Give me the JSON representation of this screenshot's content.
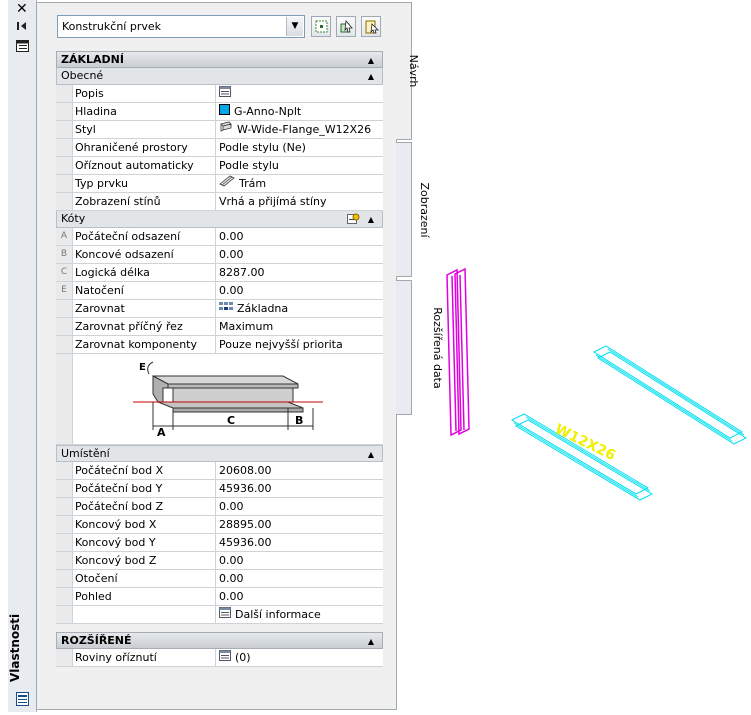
{
  "palette": {
    "title": "Vlastnosti",
    "object_type": "Konstrukční prvek",
    "tabs": [
      "Návrh",
      "Zobrazení",
      "Rozšířená data"
    ]
  },
  "sections": {
    "zakladni": {
      "label": "ZÁKLADNÍ",
      "obecne": {
        "label": "Obecné",
        "rows": [
          {
            "name": "Popis",
            "value": "",
            "icon": "list-icon"
          },
          {
            "name": "Hladina",
            "value": "G-Anno-Nplt",
            "icon": "layer-color-swatch"
          },
          {
            "name": "Styl",
            "value": "W-Wide-Flange_W12X26",
            "icon": "beam-style-icon"
          },
          {
            "name": "Ohraničené prostory",
            "value": "Podle stylu (Ne)"
          },
          {
            "name": "Oříznout automaticky",
            "value": "Podle stylu"
          },
          {
            "name": "Typ prvku",
            "value": "Trám",
            "icon": "beam-icon"
          },
          {
            "name": "Zobrazení stínů",
            "value": "Vrhá a přijímá stíny"
          }
        ]
      },
      "koty": {
        "label": "Kóty",
        "rows": [
          {
            "gutter": "A",
            "name": "Počáteční odsazení",
            "value": "0.00"
          },
          {
            "gutter": "B",
            "name": "Koncové odsazení",
            "value": "0.00"
          },
          {
            "gutter": "C",
            "name": "Logická délka",
            "value": "8287.00"
          },
          {
            "gutter": "E",
            "name": "Natočení",
            "value": "0.00"
          },
          {
            "name": "Zarovnat",
            "value": "Základna",
            "icon": "grid-icon"
          },
          {
            "name": "Zarovnat příčný řez",
            "value": "Maximum"
          },
          {
            "name": "Zarovnat komponenty",
            "value": "Pouze nejvyšší priorita"
          }
        ],
        "diagram_labels": [
          "E",
          "A",
          "C",
          "B"
        ]
      },
      "umisteni": {
        "label": "Umístění",
        "rows": [
          {
            "name": "Počáteční bod X",
            "value": "20608.00"
          },
          {
            "name": "Počáteční bod Y",
            "value": "45936.00"
          },
          {
            "name": "Počáteční bod Z",
            "value": "0.00"
          },
          {
            "name": "Koncový bod X",
            "value": "28895.00"
          },
          {
            "name": "Koncový bod Y",
            "value": "45936.00"
          },
          {
            "name": "Koncový bod Z",
            "value": "0.00"
          },
          {
            "name": "Otočení",
            "value": "0.00"
          },
          {
            "name": "Pohled",
            "value": "0.00"
          },
          {
            "name": "",
            "value": "Další informace",
            "icon": "list-icon"
          }
        ]
      }
    },
    "rozsirene": {
      "label": "ROZŠÍŘENÉ",
      "rows": [
        {
          "name": "Roviny oříznutí",
          "value": "(0)",
          "icon": "list-icon"
        }
      ]
    }
  },
  "viewport": {
    "beam_label": "W12X26",
    "colors": {
      "magenta": "#e000e0",
      "cyan": "#00e0f0",
      "yellow": "#f0f000"
    }
  }
}
